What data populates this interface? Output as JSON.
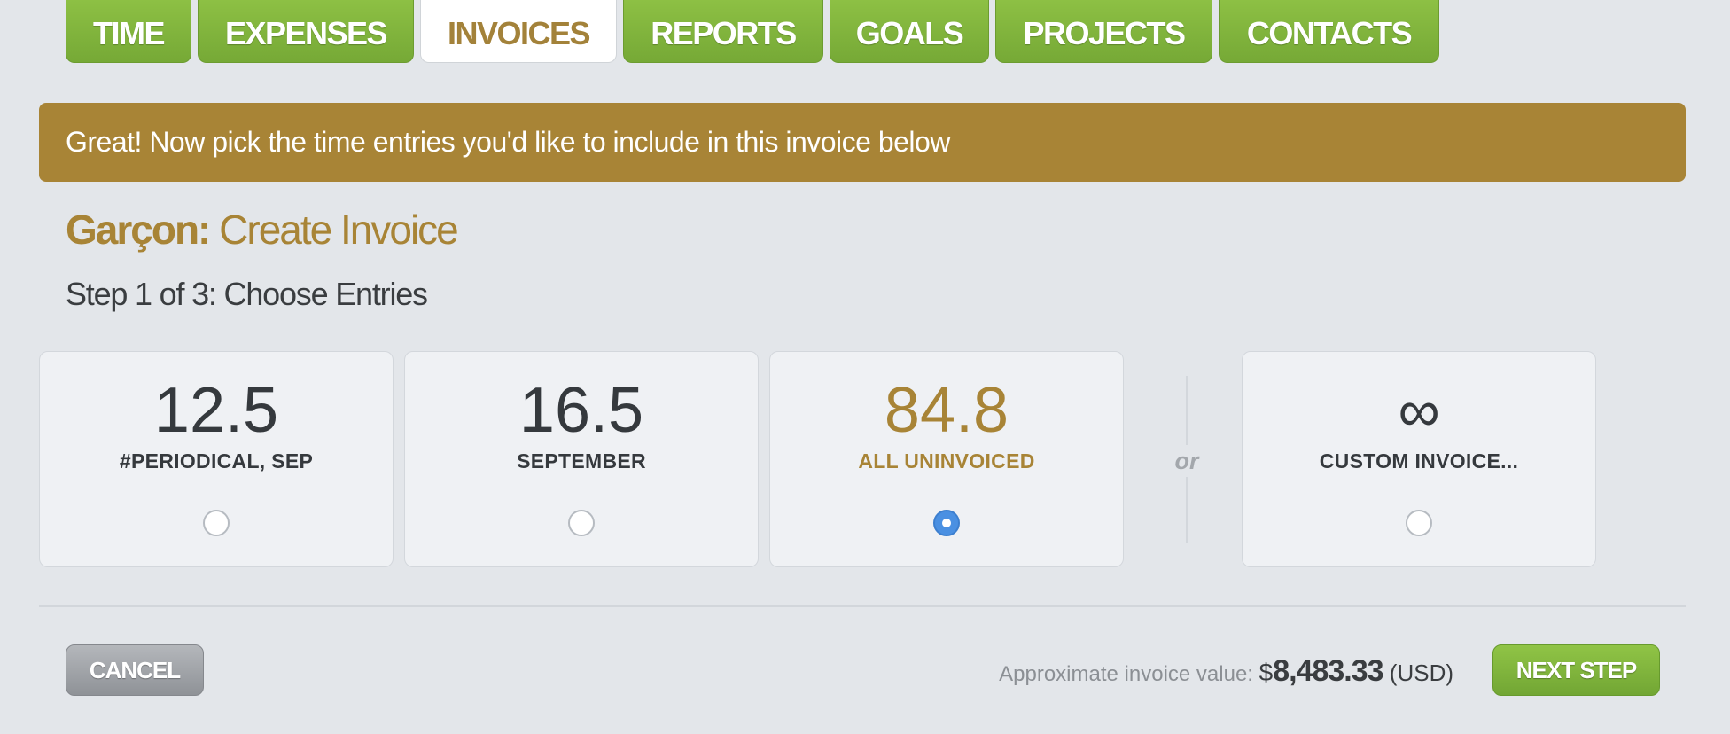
{
  "tabs": [
    {
      "label": "TIME",
      "active": false
    },
    {
      "label": "EXPENSES",
      "active": false
    },
    {
      "label": "INVOICES",
      "active": true
    },
    {
      "label": "REPORTS",
      "active": false
    },
    {
      "label": "GOALS",
      "active": false
    },
    {
      "label": "PROJECTS",
      "active": false
    },
    {
      "label": "CONTACTS",
      "active": false
    }
  ],
  "banner": {
    "message": "Great! Now pick the time entries you'd like to include in this invoice below"
  },
  "heading": {
    "client": "Garçon:",
    "title": " Create Invoice"
  },
  "step": "Step 1 of 3: Choose Entries",
  "options": [
    {
      "value": "12.5",
      "label": "#PERIODICAL, SEP",
      "selected": false
    },
    {
      "value": "16.5",
      "label": "SEPTEMBER",
      "selected": false
    },
    {
      "value": "84.8",
      "label": "ALL UNINVOICED",
      "selected": true
    }
  ],
  "separator": "or",
  "custom_option": {
    "symbol": "∞",
    "label": "CUSTOM INVOICE...",
    "selected": false
  },
  "footer": {
    "cancel_label": "CANCEL",
    "next_label": "NEXT STEP",
    "value_label": "Approximate invoice value: ",
    "currency_symbol": "$",
    "amount": "8,483.33",
    "currency_code": " (USD)"
  },
  "colors": {
    "accent_gold": "#a88436",
    "tab_green": "#7fb23c",
    "radio_selected_blue": "#4a90e2",
    "cancel_grey": "#9fa2a7"
  }
}
